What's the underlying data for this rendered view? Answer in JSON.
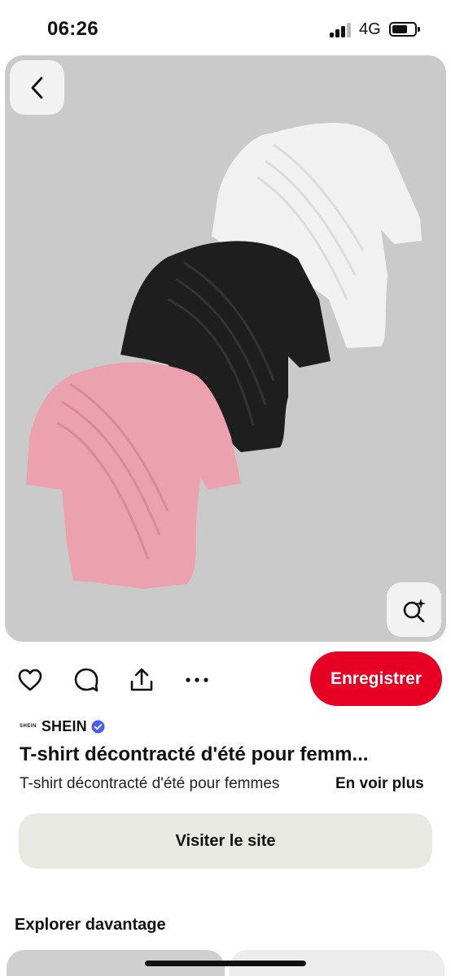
{
  "status_bar": {
    "time": "06:26",
    "network": "4G",
    "battery_level": 0.7
  },
  "pin": {
    "image_description_icons": [
      "back-chevron-icon",
      "visual-search-icon"
    ],
    "colors": {
      "background": "#cacaca",
      "shirt_white": "#f1f1f1",
      "shirt_black": "#1e1e1e",
      "shirt_pink": "#eba2ae"
    }
  },
  "actions": {
    "icons": [
      "heart-icon",
      "comment-icon",
      "share-icon",
      "more-icon"
    ],
    "save_label": "Enregistrer",
    "save_color": "#e60023"
  },
  "source": {
    "mini_logo": "SHEIN",
    "name": "SHEIN",
    "verified": true,
    "verified_color": "#4a5cf0"
  },
  "title": "T-shirt décontracté d'été pour femm...",
  "description": "T-shirt décontracté d'été pour femmes",
  "see_more_label": "En voir plus",
  "visit_label": "Visiter le site",
  "explore_title": "Explorer davantage"
}
